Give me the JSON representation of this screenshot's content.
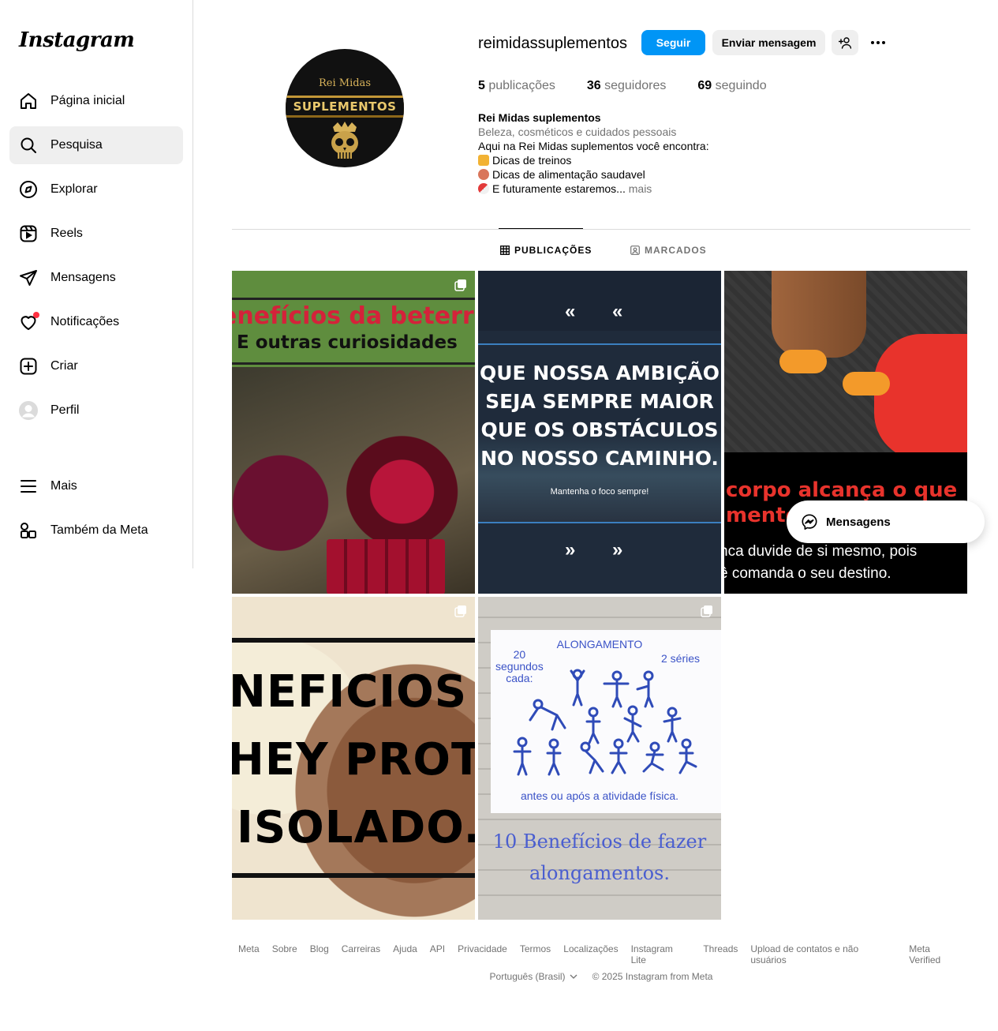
{
  "sidebar": {
    "logo": "Instagram",
    "items": [
      {
        "label": "Página inicial",
        "icon": "home-icon"
      },
      {
        "label": "Pesquisa",
        "icon": "search-icon",
        "active": true
      },
      {
        "label": "Explorar",
        "icon": "compass-icon"
      },
      {
        "label": "Reels",
        "icon": "reels-icon"
      },
      {
        "label": "Mensagens",
        "icon": "send-icon"
      },
      {
        "label": "Notificações",
        "icon": "heart-icon",
        "badge_color": "#ff3040"
      },
      {
        "label": "Criar",
        "icon": "plus-square-icon"
      },
      {
        "label": "Perfil",
        "icon": "avatar-icon"
      }
    ],
    "bottom": [
      {
        "label": "Mais",
        "icon": "menu-icon"
      },
      {
        "label": "Também da Meta",
        "icon": "meta-apps-icon"
      }
    ]
  },
  "profile": {
    "avatar_text_top": "Rei Midas",
    "avatar_text_band": "SUPLEMENTOS",
    "username": "reimidassuplementos",
    "follow_label": "Seguir",
    "message_label": "Enviar mensagem",
    "stats": {
      "posts_count": "5",
      "posts_label": "publicações",
      "followers_count": "36",
      "followers_label": "seguidores",
      "following_count": "69",
      "following_label": "seguindo"
    },
    "bio": {
      "name": "Rei Midas suplementos",
      "category": "Beleza, cosméticos e cuidados pessoais",
      "line1": "Aqui na Rei Midas suplementos você encontra:",
      "line2": "Dicas de treinos",
      "line3": "Dicas de alimentação saudavel",
      "line4": "E futuramente estaremos...",
      "more": "mais"
    }
  },
  "tabs": [
    {
      "label": "PUBLICAÇÕES",
      "active": true
    },
    {
      "label": "MARCADOS",
      "active": false
    }
  ],
  "posts": {
    "p1": {
      "line1": "enefícios da beterr",
      "line2": "E outras curiosidades"
    },
    "p2": {
      "quote1": "QUE NOSSA AMBIÇÃO",
      "quote2": "SEJA SEMPRE MAIOR",
      "quote3": "QUE OS OBSTÁCULOS",
      "quote4": "NO NOSSO CAMINHO.",
      "sub": "Mantenha o foco sempre!"
    },
    "p3": {
      "red1": "corpo alcança o que",
      "red2": "mente",
      "white1": "nca duvide de si mesmo, pois",
      "white2": "ê comanda o seu destino."
    },
    "p4": {
      "l1": "NEFICIOS D",
      "l2": "HEY PROTE",
      "l3": "ISOLADO."
    },
    "p5": {
      "title": "ALONGAMENTO",
      "seconds": "20\nsegundos\ncada:",
      "series": "2 séries",
      "foot": "antes ou após a atividade física.",
      "bottom1": "10 Benefícios de  fazer",
      "bottom2": "alongamentos."
    }
  },
  "messages_pill": {
    "label": "Mensagens"
  },
  "footer": {
    "links": [
      "Meta",
      "Sobre",
      "Blog",
      "Carreiras",
      "Ajuda",
      "API",
      "Privacidade",
      "Termos",
      "Localizações",
      "Instagram Lite",
      "Threads",
      "Upload de contatos e não usuários",
      "Meta Verified"
    ],
    "language": "Português (Brasil)",
    "copyright": "© 2025 Instagram from Meta"
  },
  "colors": {
    "accent": "#0095f6",
    "secondary_text": "#737373",
    "button_bg": "#efefef"
  }
}
